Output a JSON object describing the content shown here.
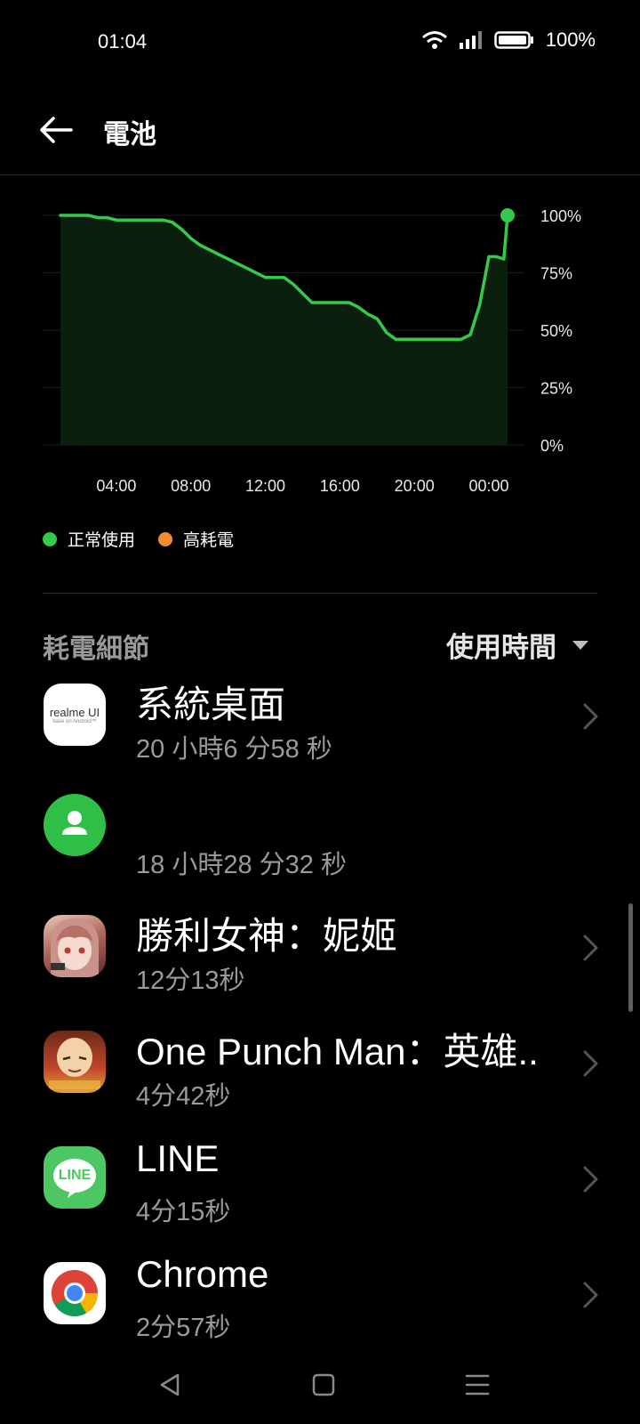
{
  "status_bar": {
    "time": "01:04",
    "battery_percent": "100%"
  },
  "header": {
    "title": "電池"
  },
  "chart_data": {
    "type": "area",
    "x_labels": [
      "04:00",
      "08:00",
      "12:00",
      "16:00",
      "20:00",
      "00:00"
    ],
    "y_labels": [
      "100%",
      "75%",
      "50%",
      "25%",
      "0%"
    ],
    "ylim": [
      0,
      100
    ],
    "series": [
      {
        "name": "正常使用",
        "x_hours": [
          0,
          1.5,
          2,
          2.5,
          3,
          4,
          5,
          5.5,
          6,
          6.5,
          7,
          7.5,
          8,
          8.5,
          9,
          10,
          11,
          11.5,
          12,
          12.5,
          13,
          13.5,
          14,
          14.5,
          15,
          15.5,
          16,
          16.5,
          17,
          17.5,
          18,
          18.5,
          19,
          19.5,
          20,
          20.5,
          21,
          21.5,
          22,
          22.5,
          23,
          23.4,
          23.8,
          24
        ],
        "values": [
          100,
          100,
          99,
          99,
          98,
          98,
          98,
          98,
          97,
          94,
          90,
          87,
          85,
          83,
          81,
          77,
          73,
          73,
          73,
          70,
          66,
          62,
          62,
          62,
          62,
          62,
          60,
          57,
          55,
          49,
          46,
          46,
          46,
          46,
          46,
          46,
          46,
          46,
          48,
          61,
          82,
          82,
          81,
          100
        ]
      }
    ],
    "legend": [
      "正常使用",
      "高耗電"
    ],
    "legend_colors": [
      "#34c94a",
      "#f48b30"
    ],
    "grid": true
  },
  "legend": {
    "normal_label": "正常使用",
    "high_label": "高耗電"
  },
  "section": {
    "title": "耗電細節",
    "sort_label": "使用時間"
  },
  "apps": [
    {
      "name": "系統桌面",
      "time": "20 小時6 分58 秒",
      "icon_text": "realme UI",
      "icon_subtext": "base on Android™"
    },
    {
      "name": "",
      "time": "18 小時28 分32 秒"
    },
    {
      "name": "勝利女神：妮姬",
      "time": "12分13秒"
    },
    {
      "name": "One Punch Man：英雄..",
      "time": "4分42秒"
    },
    {
      "name": "LINE",
      "time": "4分15秒",
      "icon_text": "LINE"
    },
    {
      "name": "Chrome",
      "time": "2分57秒"
    }
  ],
  "colors": {
    "accent": "#34c94a",
    "high": "#f48b30"
  }
}
